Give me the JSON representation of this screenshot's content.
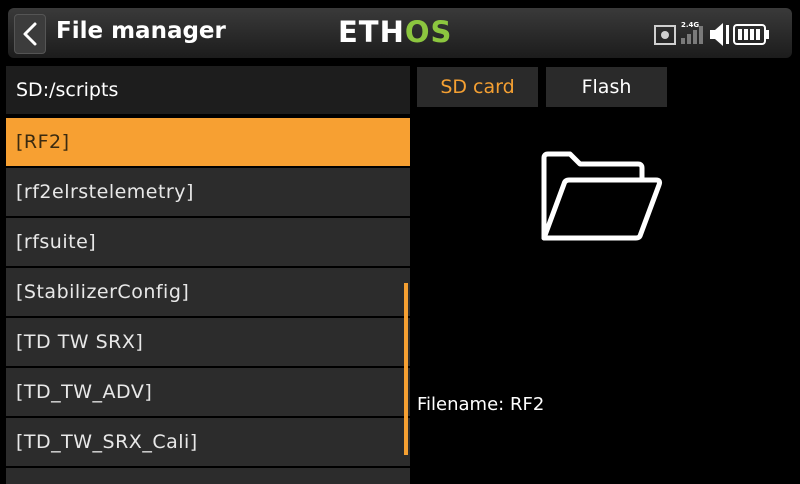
{
  "header": {
    "title": "File manager",
    "logo_white": "ETH",
    "logo_green": "OS",
    "rf_band": "2.4G",
    "icons": [
      "back-chevron-icon",
      "rf-module-icon",
      "signal-bars-icon",
      "speaker-icon",
      "battery-icon"
    ]
  },
  "browser": {
    "path": "SD:/scripts",
    "items": [
      {
        "label": "[RF2]",
        "selected": true
      },
      {
        "label": "[rf2elrstelemetry]",
        "selected": false
      },
      {
        "label": "[rfsuite]",
        "selected": false
      },
      {
        "label": "[StabilizerConfig]",
        "selected": false
      },
      {
        "label": "[TD TW SRX]",
        "selected": false
      },
      {
        "label": "[TD_TW_ADV]",
        "selected": false
      },
      {
        "label": "[TD_TW_SRX_Cali]",
        "selected": false
      }
    ]
  },
  "tabs": {
    "sd_card": "SD card",
    "flash": "Flash",
    "active": "sd_card"
  },
  "preview": {
    "icon": "folder-icon",
    "filename_text": "Filename: RF2"
  },
  "colors": {
    "accent": "#f7a032",
    "logo_green": "#8cc63f",
    "item_bg": "#2c2c2c",
    "background": "#000000"
  }
}
